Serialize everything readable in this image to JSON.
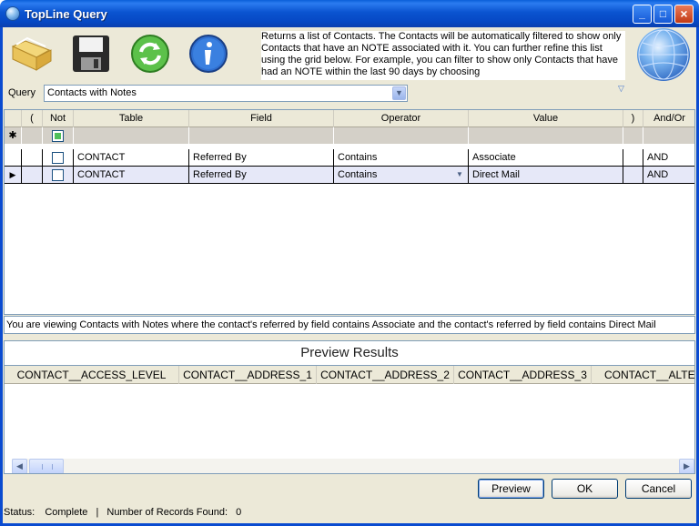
{
  "window": {
    "title": "TopLine Query",
    "minimize_glyph": "_",
    "maximize_glyph": "□",
    "close_glyph": "×"
  },
  "toolbar": {
    "icons": [
      "folder-icon",
      "save-icon",
      "refresh-icon",
      "info-icon"
    ]
  },
  "description": "Returns a list of Contacts. The Contacts will be automatically filtered to show only Contacts that have an NOTE associated with it. You can further refine this list using the grid below. For example, you can filter to show only Contacts that have had an NOTE within the last 90 days by choosing",
  "query": {
    "label": "Query",
    "selected": "Contacts with Notes"
  },
  "grid": {
    "columns": [
      "",
      "(",
      "Not",
      "Table",
      "Field",
      "Operator",
      "Value",
      ")",
      "And/Or"
    ],
    "new_row_glyph": "✱",
    "current_row_glyph": "▶",
    "rows": [
      {
        "table": "CONTACT",
        "field": "Referred By",
        "operator": "Contains",
        "value": "Associate",
        "andor": "AND"
      },
      {
        "table": "CONTACT",
        "field": "Referred By",
        "operator": "Contains",
        "value": "Direct Mail",
        "andor": "AND"
      }
    ]
  },
  "summary": "You are viewing Contacts with Notes where the contact's referred by field contains Associate and the contact's referred by field contains Direct Mail",
  "preview": {
    "title": "Preview Results",
    "columns": [
      "CONTACT__ACCESS_LEVEL",
      "CONTACT__ADDRESS_1",
      "CONTACT__ADDRESS_2",
      "CONTACT__ADDRESS_3",
      "CONTACT__ALTER"
    ]
  },
  "buttons": {
    "preview": "Preview",
    "ok": "OK",
    "cancel": "Cancel"
  },
  "status": {
    "label": "Status:",
    "value": "Complete",
    "records_label": "Number of Records Found:",
    "records_count": "0",
    "separator": "|"
  }
}
